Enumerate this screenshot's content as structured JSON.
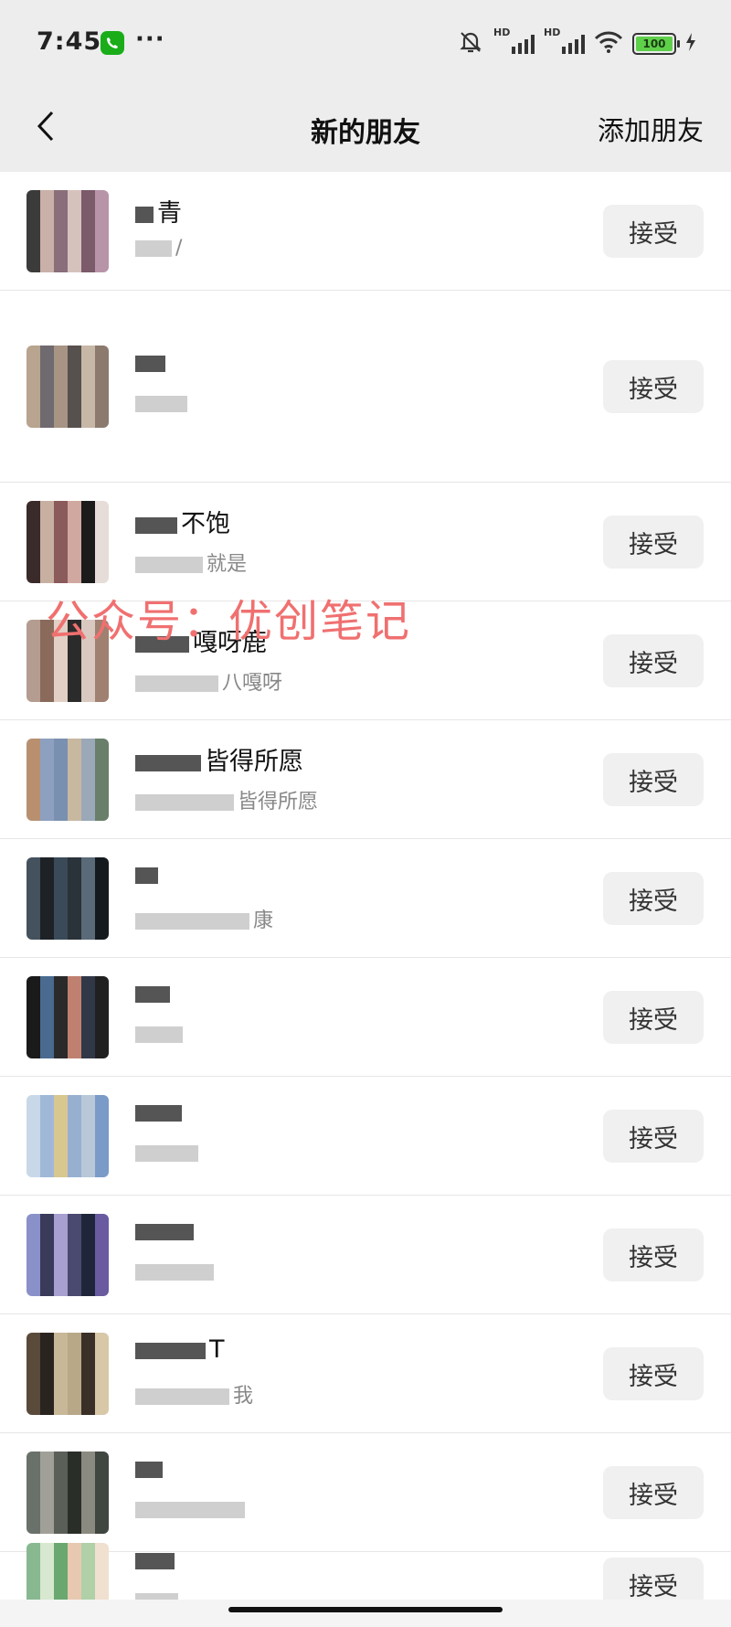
{
  "status_bar": {
    "time": "7:45",
    "more": "···",
    "signal_tag": "HD",
    "battery": "100"
  },
  "header": {
    "back_icon": "chevron-left-icon",
    "title": "新的朋友",
    "action": "添加朋友"
  },
  "accept_label": "接受",
  "requests": [
    {
      "name": "青",
      "sub": "/",
      "avatar_colors": [
        "#3b3b3b",
        "#c9b0a8",
        "#8a6e7a",
        "#d6c2bd",
        "#7b5a6a",
        "#b894a8"
      ]
    },
    {
      "name": "",
      "sub": "",
      "avatar_colors": [
        "#8c7a6e",
        "#b8a48f",
        "#6f6a70",
        "#a79484",
        "#56504e",
        "#c7b7a6"
      ]
    },
    {
      "name": "不饱",
      "sub": "就是",
      "avatar_colors": [
        "#1b1b1b",
        "#e6dcd8",
        "#3a2a2a",
        "#c8b0a0",
        "#8b5a5a",
        "#d0a8a0"
      ]
    },
    {
      "name": "嘎呀鹿",
      "sub": "八嘎呀",
      "avatar_colors": [
        "#2b2b2b",
        "#d8c8c0",
        "#a08070",
        "#b49c90",
        "#8a6a5a",
        "#e2d0c6"
      ]
    },
    {
      "name": "皆得所愿",
      "sub": "皆得所愿",
      "avatar_colors": [
        "#7a90b0",
        "#c8b8a0",
        "#9aa8b8",
        "#6a7f6a",
        "#b89070",
        "#8da0c0"
      ]
    },
    {
      "name": "",
      "sub": "康",
      "avatar_colors": [
        "#1e2226",
        "#3a4a58",
        "#2a323a",
        "#5a6a78",
        "#151a1e",
        "#44525e"
      ]
    },
    {
      "name": "",
      "sub": "",
      "avatar_colors": [
        "#1a1a1a",
        "#4a6a90",
        "#2a2a2a",
        "#c08070",
        "#303848",
        "#202020"
      ]
    },
    {
      "name": "",
      "sub": "",
      "avatar_colors": [
        "#7a9ac8",
        "#c8d8e8",
        "#a0b8d8",
        "#d8c890",
        "#98b0d0",
        "#b8c8d8"
      ]
    },
    {
      "name": "",
      "sub": "",
      "avatar_colors": [
        "#20263a",
        "#6a5aa0",
        "#8a90c8",
        "#3a3a5a",
        "#a8a0d0",
        "#4a4a70"
      ]
    },
    {
      "name": "T",
      "sub": "我",
      "avatar_colors": [
        "#b8a888",
        "#3a3028",
        "#d8c8a8",
        "#5a4a3a",
        "#2a2420",
        "#c8b898"
      ]
    },
    {
      "name": "",
      "sub": "",
      "avatar_colors": [
        "#5a6058",
        "#2a2e28",
        "#8a8a80",
        "#404640",
        "#6a706a",
        "#a0a098"
      ]
    },
    {
      "name": "",
      "sub": "",
      "avatar_colors": [
        "#d8e8d0",
        "#6aa870",
        "#e8c8b0",
        "#b0d0a8",
        "#f0e0d0",
        "#88b890"
      ]
    }
  ],
  "watermark": "公众号：优创笔记"
}
